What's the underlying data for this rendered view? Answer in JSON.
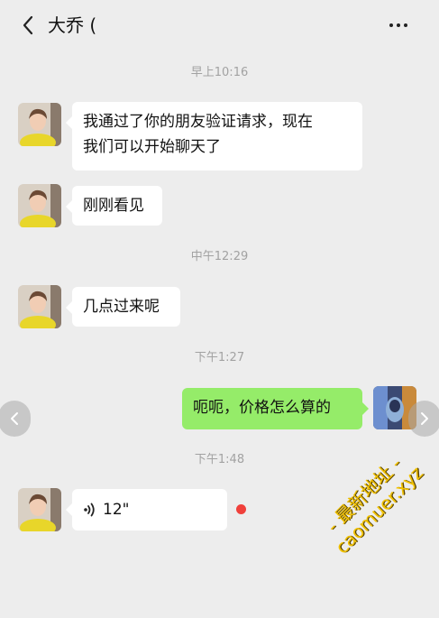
{
  "header": {
    "title": "大乔 (",
    "back_icon": "chevron-left-icon",
    "more_icon": "more-dots-icon"
  },
  "messages": [
    {
      "type": "timestamp",
      "text": "早上10:16"
    },
    {
      "type": "incoming",
      "text_lines": [
        "我通过了你的朋友验证请求，现在",
        "我们可以开始聊天了"
      ]
    },
    {
      "type": "incoming",
      "text": "刚刚看见"
    },
    {
      "type": "timestamp",
      "text": "中午12:29"
    },
    {
      "type": "incoming",
      "text": "几点过来呢"
    },
    {
      "type": "timestamp",
      "text": "下午1:27"
    },
    {
      "type": "outgoing",
      "text": "呃呃，价格怎么算的"
    },
    {
      "type": "timestamp",
      "text": "下午1:48"
    },
    {
      "type": "incoming-voice",
      "duration": "12\"",
      "icon": "voice-wave-icon",
      "unread": true
    }
  ],
  "watermark": {
    "line1": "- 最新地址 -",
    "line2": "caomuer.xyz"
  },
  "colors": {
    "background": "#ededed",
    "incoming_bubble": "#ffffff",
    "outgoing_bubble": "#95ec69",
    "timestamp": "#a2a2a2",
    "unread_dot": "#f0403b",
    "watermark": "#f2c200"
  }
}
